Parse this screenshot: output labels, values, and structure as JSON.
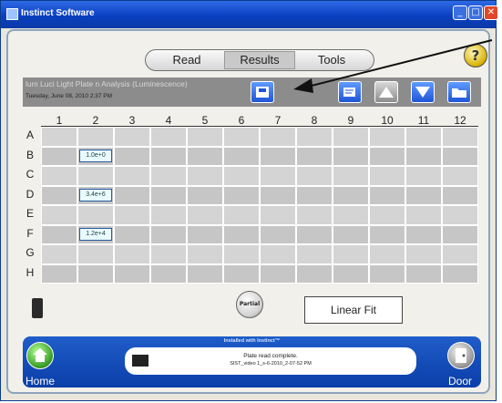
{
  "window": {
    "title": "Instinct Software",
    "accent": "#0a3fc0",
    "close_color": "#e0482a"
  },
  "tabs": [
    {
      "label": "Read"
    },
    {
      "label": "Results"
    },
    {
      "label": "Tools"
    }
  ],
  "header": {
    "experiment_title": "lum Luci Light Plate n Analysis (Luminescence)",
    "date": "Tuesday, June 08, 2010 2:37 PM"
  },
  "toolbar_icons": [
    "save-plate-icon",
    "edit-icon",
    "up-arrow-icon",
    "down-arrow-icon",
    "open-folder-icon"
  ],
  "plate": {
    "columns": [
      "1",
      "2",
      "3",
      "4",
      "5",
      "6",
      "7",
      "8",
      "9",
      "10",
      "11",
      "12"
    ],
    "rows": [
      "A",
      "B",
      "C",
      "D",
      "E",
      "F",
      "G",
      "H"
    ],
    "wells": [
      {
        "row": "B",
        "col": "2",
        "value": "1.0e+0"
      },
      {
        "row": "D",
        "col": "2",
        "value": "3.4e+6"
      },
      {
        "row": "F",
        "col": "2",
        "value": "1.2e+4"
      }
    ],
    "well_color": "#d4d4d4",
    "well_alt_color": "#c6c6c6"
  },
  "controls": {
    "partial_label": "Partial",
    "fit_label": "Linear Fit"
  },
  "footer": {
    "installed_note": "Installed with Instinct™",
    "status_line1": "Plate read complete.",
    "status_line2": "SIST_video 1_s-6-2010_2-07-52 PM",
    "home_label": "Home",
    "door_label": "Door"
  }
}
